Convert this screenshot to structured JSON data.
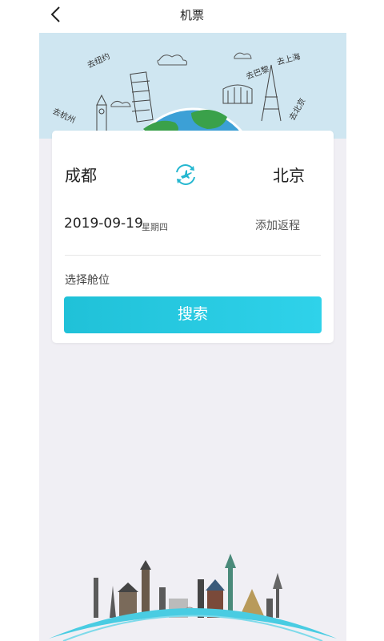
{
  "nav": {
    "title": "机票"
  },
  "banner": {
    "labels": [
      "去纽约",
      "去巴黎",
      "去上海",
      "去杭州",
      "去北京"
    ]
  },
  "flight": {
    "from_city": "成都",
    "to_city": "北京",
    "date": "2019-09-19",
    "weekday": "星期四",
    "add_return": "添加返程",
    "cabin_label": "选择舱位",
    "search_label": "搜索"
  },
  "colors": {
    "accent": "#20c1d8",
    "banner_bg": "#cfe6f1",
    "page_bg": "#f0eff4"
  },
  "icons": {
    "back": "chevron-left-icon",
    "swap": "swap-flight-icon"
  }
}
